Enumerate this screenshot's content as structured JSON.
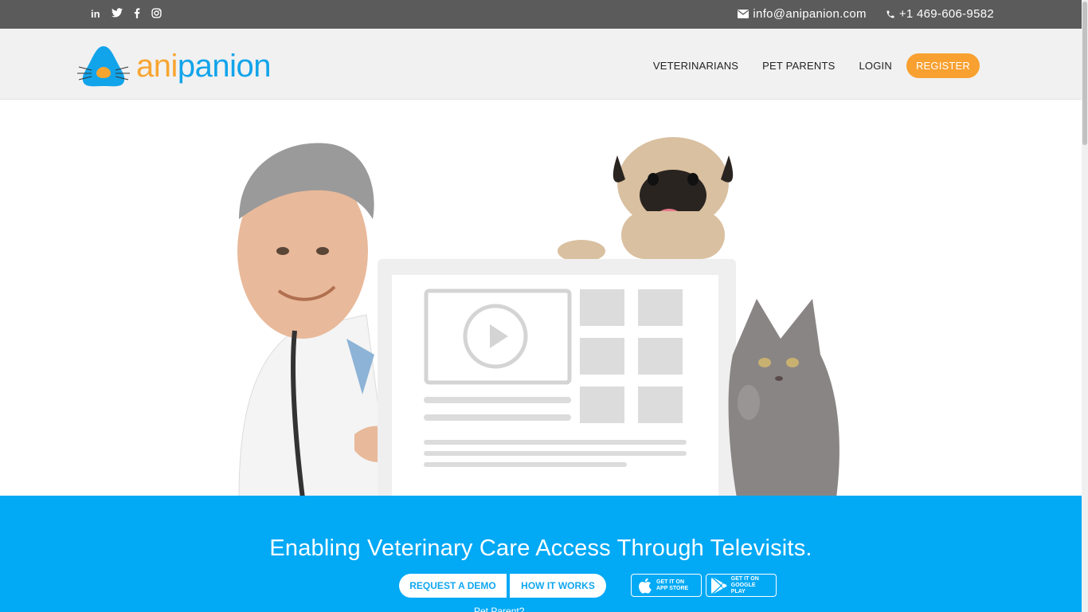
{
  "topbar": {
    "social": {
      "linkedin": "in"
    },
    "email": "info@anipanion.com",
    "phone": "+1 469-606-9582"
  },
  "brand": {
    "part1": "ani",
    "part2": "panion",
    "colors": {
      "orange": "#f7a531",
      "blue": "#12a4ea"
    }
  },
  "nav": {
    "veterinarians": "VETERINARIANS",
    "pet_parents": "PET PARENTS",
    "login": "LOGIN",
    "register": "REGISTER"
  },
  "hero": {
    "headline": "Enabling Veterinary Care Access Through Televisits.",
    "request_demo": "REQUEST A DEMO",
    "how_it_works": "HOW IT WORKS",
    "app_store": {
      "line1": "GET IT ON",
      "line2": "APP STORE"
    },
    "google_play": {
      "line1": "GET IT ON",
      "line2": "GOOGLE PLAY"
    },
    "pet_parent": "Pet Parent?"
  },
  "colors": {
    "topbar": "#5b5b5b",
    "header": "#f1f1f1",
    "band": "#02a9f5",
    "register_button": "#f8a030"
  }
}
